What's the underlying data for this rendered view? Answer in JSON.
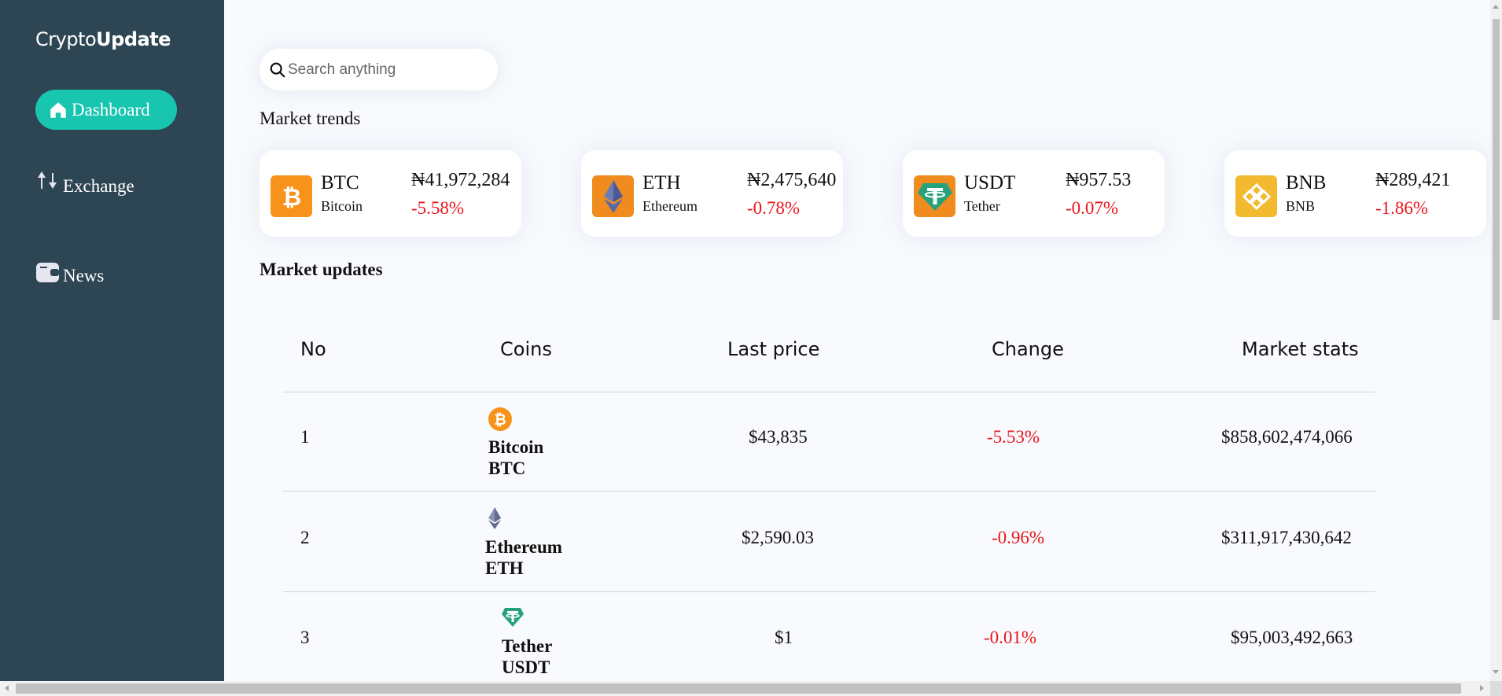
{
  "brand": {
    "light": "Crypto",
    "bold": "Update"
  },
  "nav": [
    {
      "label": "Dashboard",
      "icon": "home-icon",
      "active": true
    },
    {
      "label": "Exchange",
      "icon": "exchange-arrows-icon",
      "active": false
    },
    {
      "label": "News",
      "icon": "wallet-icon",
      "active": false
    }
  ],
  "search": {
    "placeholder": "Search anything",
    "value": ""
  },
  "trends_title": "Market trends",
  "trends": [
    {
      "symbol": "BTC",
      "name": "Bitcoin",
      "price": "₦41,972,284",
      "change": "-5.58%",
      "icon": "bitcoin-logo",
      "color": "#f7931a"
    },
    {
      "symbol": "ETH",
      "name": "Ethereum",
      "price": "₦2,475,640",
      "change": "-0.78%",
      "icon": "ethereum-logo",
      "color": "#f08c1d"
    },
    {
      "symbol": "USDT",
      "name": "Tether",
      "price": "₦957.53",
      "change": "-0.07%",
      "icon": "tether-logo",
      "color": "#f08c1d"
    },
    {
      "symbol": "BNB",
      "name": "BNB",
      "price": "₦289,421",
      "change": "-1.86%",
      "icon": "bnb-logo",
      "color": "#f3ba2f"
    }
  ],
  "updates_title": "Market updates",
  "table": {
    "headers": {
      "no": "No",
      "coins": "Coins",
      "last_price": "Last price",
      "change": "Change",
      "market_stats": "Market stats"
    },
    "rows": [
      {
        "no": "1",
        "name": "Bitcoin",
        "symbol": "BTC",
        "price": "$43,835",
        "change": "-5.53%",
        "market_cap": "$858,602,474,066",
        "icon": "bitcoin-icon"
      },
      {
        "no": "2",
        "name": "Ethereum",
        "symbol": "ETH",
        "price": "$2,590.03",
        "change": "-0.96%",
        "market_cap": "$311,917,430,642",
        "icon": "ethereum-icon"
      },
      {
        "no": "3",
        "name": "Tether",
        "symbol": "USDT",
        "price": "$1",
        "change": "-0.01%",
        "market_cap": "$95,003,492,663",
        "icon": "tether-icon"
      }
    ]
  },
  "colors": {
    "sidebar": "#2e4553",
    "accent": "#18c6b0",
    "negative": "#e8161d",
    "background": "#f8fafd"
  }
}
